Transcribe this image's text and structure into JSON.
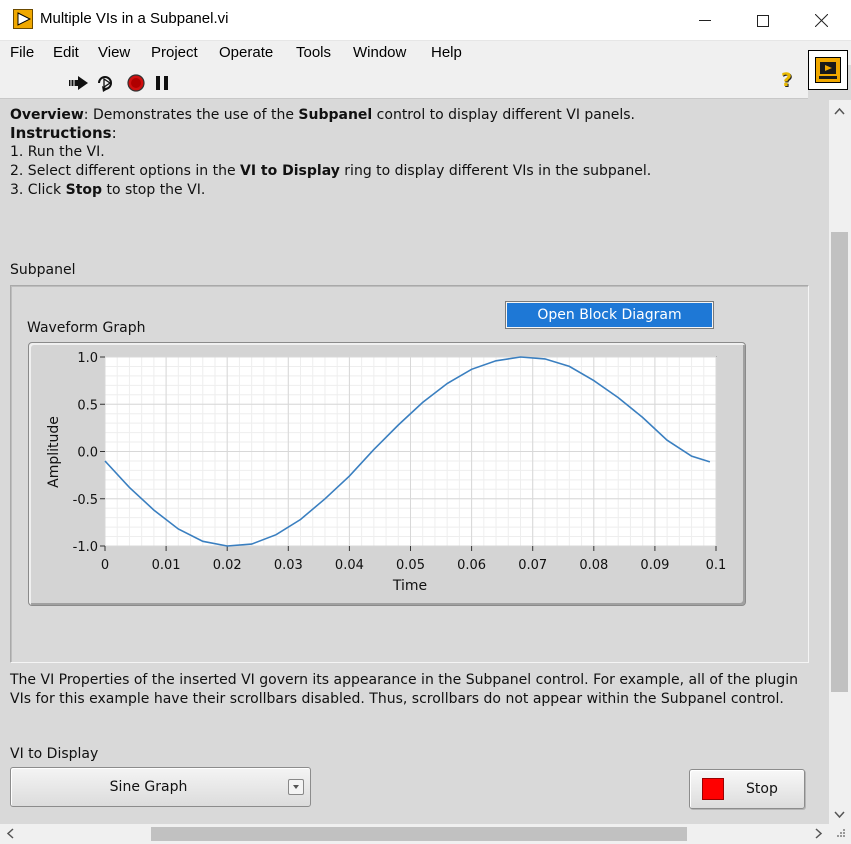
{
  "window": {
    "title": "Multiple VIs in a Subpanel.vi",
    "controls": {
      "minimize": "—",
      "maximize": "☐",
      "close": "✕"
    }
  },
  "menu": [
    "File",
    "Edit",
    "View",
    "Project",
    "Operate",
    "Tools",
    "Window",
    "Help"
  ],
  "toolbar": {
    "buttons": [
      "run-arrow-icon",
      "run-continuously-icon",
      "abort-icon",
      "pause-icon"
    ],
    "help_label": "?"
  },
  "front_panel": {
    "overview_label": "Overview",
    "overview_text": ": Demonstrates the use of the ",
    "overview_bold": "Subpanel",
    "overview_rest": " control to display different VI panels.",
    "instructions_label": "Instructions",
    "instructions_colon": ":",
    "step1": "1. Run the VI.",
    "step2_pre": "2. Select different options in the ",
    "step2_bold": "VI to Display",
    "step2_post": " ring to display different VIs in the subpanel.",
    "step3_pre": "3. Click ",
    "step3_bold": "Stop",
    "step3_post": " to stop the VI.",
    "subpanel_label": "Subpanel",
    "open_block_diagram": "Open Block Diagram",
    "graph_label": "Waveform Graph",
    "note_line1": "The VI Properties of the inserted VI govern its appearance in the Subpanel control. For example, all of the plugin",
    "note_line2": "VIs for this example have their scrollbars disabled. Thus, scrollbars do not appear within the Subpanel control.",
    "vi_to_display_label": "VI to Display",
    "vi_to_display_value": "Sine Graph",
    "stop_label": "Stop"
  },
  "chart_data": {
    "type": "line",
    "title": "",
    "xlabel": "Time",
    "ylabel": "Amplitude",
    "xlim": [
      0,
      0.1
    ],
    "ylim": [
      -1.0,
      1.0
    ],
    "x_ticks": [
      "0",
      "0.01",
      "0.02",
      "0.03",
      "0.04",
      "0.05",
      "0.06",
      "0.07",
      "0.08",
      "0.09",
      "0.1"
    ],
    "y_ticks": [
      "1.0",
      "0.5",
      "0.0",
      "-0.5",
      "-1.0"
    ],
    "grid": true,
    "series": [
      {
        "color": "#3a7fc0",
        "x": [
          0,
          0.004,
          0.008,
          0.012,
          0.016,
          0.02,
          0.024,
          0.028,
          0.032,
          0.036,
          0.04,
          0.044,
          0.048,
          0.052,
          0.056,
          0.06,
          0.064,
          0.068,
          0.072,
          0.076,
          0.08,
          0.084,
          0.088,
          0.092,
          0.096,
          0.099
        ],
        "values": [
          -0.1,
          -0.38,
          -0.62,
          -0.82,
          -0.95,
          -1.0,
          -0.98,
          -0.88,
          -0.72,
          -0.5,
          -0.26,
          0.02,
          0.28,
          0.52,
          0.72,
          0.87,
          0.96,
          1.0,
          0.98,
          0.9,
          0.75,
          0.57,
          0.36,
          0.12,
          -0.05,
          -0.11
        ]
      }
    ]
  }
}
